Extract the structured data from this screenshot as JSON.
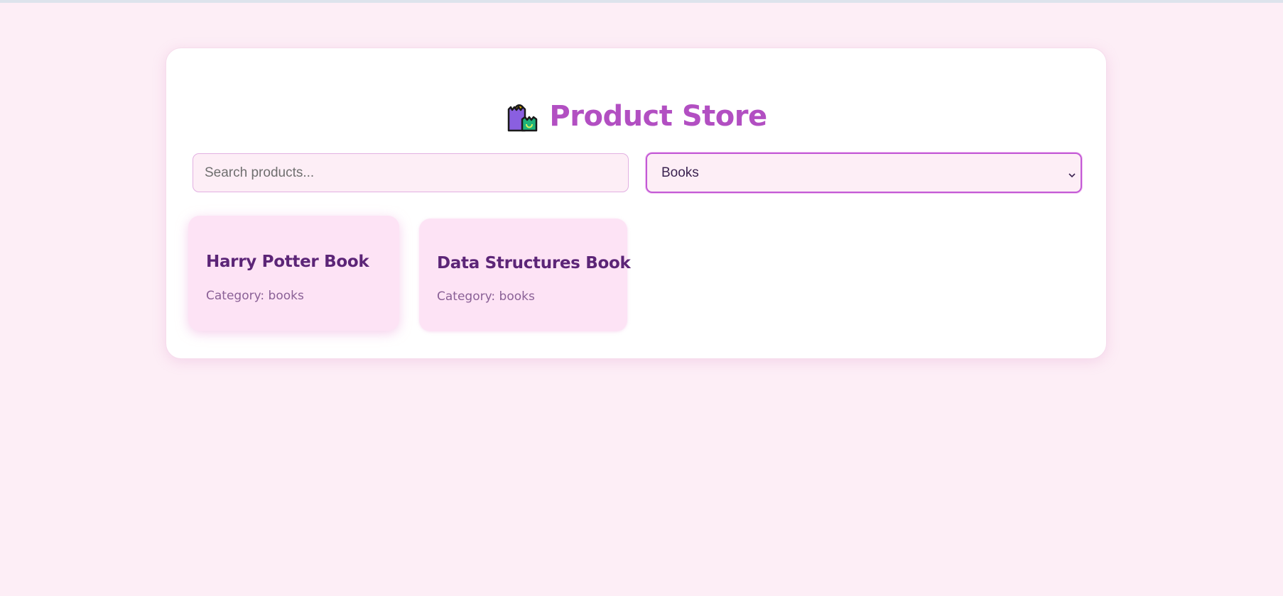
{
  "header": {
    "title": "Product Store",
    "icon": "shopping-bags-icon"
  },
  "search": {
    "placeholder": "Search products...",
    "value": ""
  },
  "category_select": {
    "selected": "Books",
    "icon": "chevron-down-icon"
  },
  "products": [
    {
      "name": "Harry Potter Book",
      "category": "Category: books"
    },
    {
      "name": "Data Structures Book",
      "category": "Category: books"
    }
  ],
  "colors": {
    "page_background": "#fdeef6",
    "accent": "#b24fc2",
    "product_card": "#fde3f5",
    "product_title": "#5c2577"
  }
}
